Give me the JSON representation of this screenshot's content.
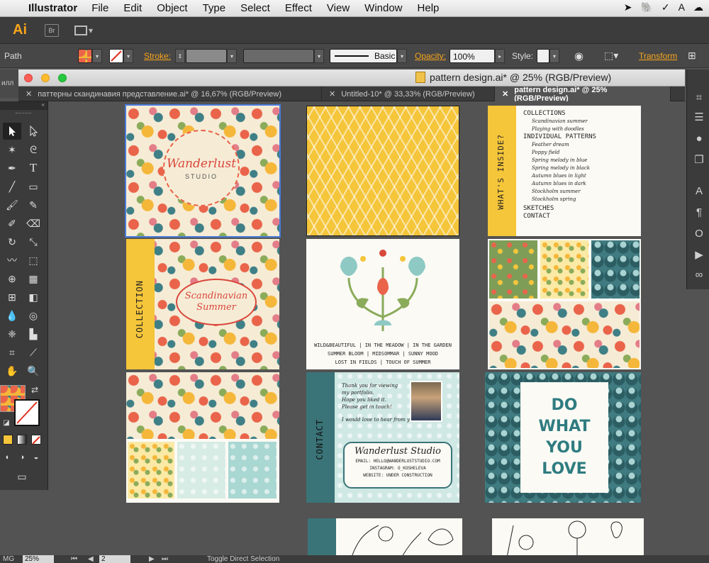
{
  "menubar": {
    "apple": "",
    "app": "Illustrator",
    "items": [
      "File",
      "Edit",
      "Object",
      "Type",
      "Select",
      "Effect",
      "View",
      "Window",
      "Help"
    ]
  },
  "appbar": {
    "logo": "Ai",
    "bridge": "Br"
  },
  "control": {
    "object_type": "Path",
    "stroke_label": "Stroke:",
    "brush": "Basic",
    "opacity_label": "Opacity:",
    "opacity_value": "100%",
    "style_label": "Style:",
    "transform_label": "Transform"
  },
  "document": {
    "title": "pattern design.ai* @ 25% (RGB/Preview)",
    "left_sliver": "илл"
  },
  "tabs": [
    {
      "label": "паттерны скандинавия представление.ai* @ 16,67% (RGB/Preview)",
      "active": false
    },
    {
      "label": "Untitled-10* @ 33,33% (RGB/Preview)",
      "active": false
    },
    {
      "label": "pattern design.ai* @ 25% (RGB/Preview)",
      "active": true
    }
  ],
  "artboards": {
    "cover": {
      "title": "Wanderlust",
      "subtitle": "STUDIO"
    },
    "contents": {
      "side": "WHAT'S INSIDE?",
      "collections": "COLLECTIONS",
      "collections_items": [
        "Scandinavian summer",
        "Playing with doodles"
      ],
      "individual": "INDIVIDUAL PATTERNS",
      "individual_items": [
        "Feather dream",
        "Poppy field",
        "Spring melody in blue",
        "Spring melody in black",
        "Autumn blues in light",
        "Autumn blues in dark",
        "Stockholm summer",
        "Stockholm spring"
      ],
      "sketches": "SKETCHES",
      "contact": "CONTACT"
    },
    "collection": {
      "side": "COLLECTION",
      "title_line1": "Scandinavian",
      "title_line2": "Summer"
    },
    "motif": {
      "lines": [
        "WILD&BEAUTIFUL | IN THE MEADOW | IN THE GARDEN",
        "SUMMER BLOOM | MIDSOMMAR | SUNNY MOOD",
        "LOST IN FIELDS | TOUCH OF SUMMER"
      ]
    },
    "contact_card": {
      "side": "CONTACT",
      "note": [
        "Thank you for viewing",
        "my portfolio.",
        "Hope you liked it.",
        "Please get in touch!",
        "",
        "I would love to hear from you."
      ],
      "name": "Wanderlust Studio",
      "email": "EMAIL: HELLO@WANDERLUSTSTUDIO.COM",
      "instagram": "INSTAGRAM: O_KOSHELEVA",
      "website": "WEBSITE: UNDER CONSTRUCTION"
    },
    "dowhat": {
      "lines": [
        "DO",
        "WHAT",
        "YOU",
        "LOVE"
      ]
    }
  },
  "statusbar": {
    "zoom": "25%",
    "page": "2",
    "status": "Toggle Direct Selection"
  },
  "colors": {
    "accent": "#f7a51c",
    "yellow": "#f5c53a",
    "teal": "#3a7478",
    "coral": "#e9644a"
  }
}
